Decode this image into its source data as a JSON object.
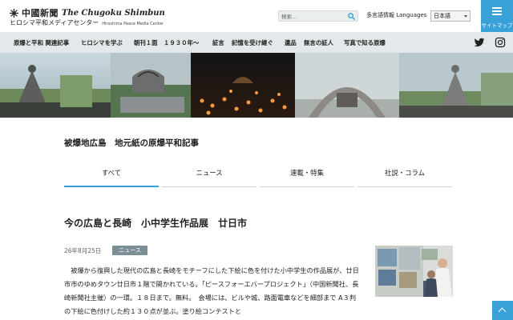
{
  "header": {
    "logo_jp": "中國新聞",
    "logo_en": "The Chugoku Shimbun",
    "sub_jp": "ヒロシマ平和メディアセンター",
    "sub_en": "Hiroshima Peace Media Center",
    "search_placeholder": "検索...",
    "lang_label": "多言語情報 Languages",
    "lang_selected": "日本語",
    "sitemap_label": "サイトマップ"
  },
  "nav": {
    "items": [
      "原爆と平和 関連記事",
      "ヒロシマを学ぶ",
      "朝刊１面　１９３０年〜",
      "証言",
      "記憶を受け継ぐ",
      "遺品",
      "無言の証人",
      "写真で知る原爆"
    ],
    "social": [
      "twitter-icon",
      "instagram-icon"
    ]
  },
  "section": {
    "title": "被爆地広島　地元紙の原爆平和記事",
    "tabs": [
      "すべて",
      "ニュース",
      "連載・特集",
      "社説・コラム"
    ],
    "active_tab": 0
  },
  "article": {
    "title": "今の広島と長崎　小中学生作品展　廿日市",
    "date": "26年8月25日",
    "badge": "ニュース",
    "body": "　被爆から復興した現代の広島と長崎をモチーフにした下絵に色を付けた小中学生の作品展が、廿日市市のゆめタウン廿日市１階で開かれている。「ピースフォーエバープロジェクト」（中国新聞社、長崎新聞社主催）の一環。１８日まで。無料。　会場には、ビルや城、路面電車などを細部まで A３判の下絵に色付けした約１３０点が並ぶ。塗り絵コンテストと"
  },
  "colors": {
    "accent": "#3aa0d8",
    "nav_bg": "#e3e9ea",
    "badge_bg": "#7d8f96"
  }
}
